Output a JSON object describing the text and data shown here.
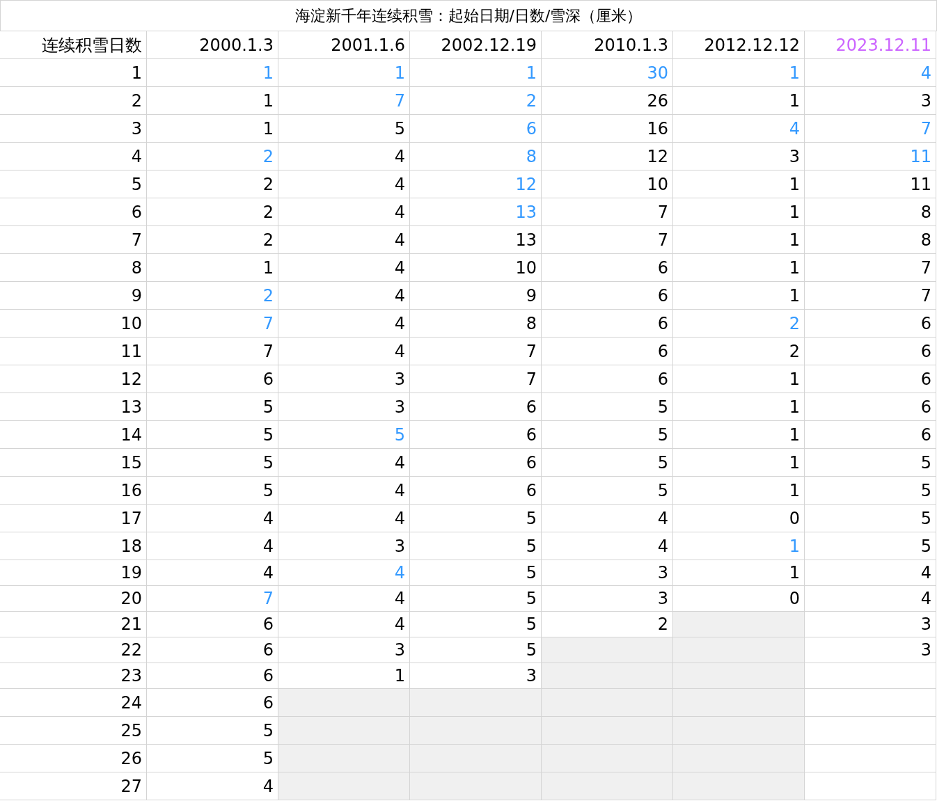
{
  "title": "海淀新千年连续积雪：起始日期/日数/雪深（厘米）",
  "columns": [
    {
      "label": "连续积雪日数"
    },
    {
      "label": "2000.1.3"
    },
    {
      "label": "2001.1.6"
    },
    {
      "label": "2002.12.19"
    },
    {
      "label": "2010.1.3"
    },
    {
      "label": "2012.12.12"
    },
    {
      "label": "2023.12.11",
      "color": "#cc66ff"
    }
  ],
  "rows": [
    {
      "day": "1",
      "cells": [
        {
          "value": "1",
          "highlight": true
        },
        {
          "value": "1",
          "highlight": true
        },
        {
          "value": "1",
          "highlight": true
        },
        {
          "value": "30",
          "highlight": true
        },
        {
          "value": "1",
          "highlight": true
        },
        {
          "value": "4",
          "highlight": true
        }
      ]
    },
    {
      "day": "2",
      "cells": [
        {
          "value": "1",
          "highlight": false
        },
        {
          "value": "7",
          "highlight": true
        },
        {
          "value": "2",
          "highlight": true
        },
        {
          "value": "26",
          "highlight": false
        },
        {
          "value": "1",
          "highlight": false
        },
        {
          "value": "3",
          "highlight": false
        }
      ]
    },
    {
      "day": "3",
      "cells": [
        {
          "value": "1",
          "highlight": false
        },
        {
          "value": "5",
          "highlight": false
        },
        {
          "value": "6",
          "highlight": true
        },
        {
          "value": "16",
          "highlight": false
        },
        {
          "value": "4",
          "highlight": true
        },
        {
          "value": "7",
          "highlight": true
        }
      ]
    },
    {
      "day": "4",
      "cells": [
        {
          "value": "2",
          "highlight": true
        },
        {
          "value": "4",
          "highlight": false
        },
        {
          "value": "8",
          "highlight": true
        },
        {
          "value": "12",
          "highlight": false
        },
        {
          "value": "3",
          "highlight": false
        },
        {
          "value": "11",
          "highlight": true
        }
      ]
    },
    {
      "day": "5",
      "cells": [
        {
          "value": "2",
          "highlight": false
        },
        {
          "value": "4",
          "highlight": false
        },
        {
          "value": "12",
          "highlight": true
        },
        {
          "value": "10",
          "highlight": false
        },
        {
          "value": "1",
          "highlight": false
        },
        {
          "value": "11",
          "highlight": false
        }
      ]
    },
    {
      "day": "6",
      "cells": [
        {
          "value": "2",
          "highlight": false
        },
        {
          "value": "4",
          "highlight": false
        },
        {
          "value": "13",
          "highlight": true
        },
        {
          "value": "7",
          "highlight": false
        },
        {
          "value": "1",
          "highlight": false
        },
        {
          "value": "8",
          "highlight": false
        }
      ]
    },
    {
      "day": "7",
      "cells": [
        {
          "value": "2",
          "highlight": false
        },
        {
          "value": "4",
          "highlight": false
        },
        {
          "value": "13",
          "highlight": false
        },
        {
          "value": "7",
          "highlight": false
        },
        {
          "value": "1",
          "highlight": false
        },
        {
          "value": "8",
          "highlight": false
        }
      ]
    },
    {
      "day": "8",
      "cells": [
        {
          "value": "1",
          "highlight": false
        },
        {
          "value": "4",
          "highlight": false
        },
        {
          "value": "10",
          "highlight": false
        },
        {
          "value": "6",
          "highlight": false
        },
        {
          "value": "1",
          "highlight": false
        },
        {
          "value": "7",
          "highlight": false
        }
      ]
    },
    {
      "day": "9",
      "cells": [
        {
          "value": "2",
          "highlight": true
        },
        {
          "value": "4",
          "highlight": false
        },
        {
          "value": "9",
          "highlight": false
        },
        {
          "value": "6",
          "highlight": false
        },
        {
          "value": "1",
          "highlight": false
        },
        {
          "value": "7",
          "highlight": false
        }
      ]
    },
    {
      "day": "10",
      "cells": [
        {
          "value": "7",
          "highlight": true
        },
        {
          "value": "4",
          "highlight": false
        },
        {
          "value": "8",
          "highlight": false
        },
        {
          "value": "6",
          "highlight": false
        },
        {
          "value": "2",
          "highlight": true
        },
        {
          "value": "6",
          "highlight": false
        }
      ]
    },
    {
      "day": "11",
      "cells": [
        {
          "value": "7",
          "highlight": false
        },
        {
          "value": "4",
          "highlight": false
        },
        {
          "value": "7",
          "highlight": false
        },
        {
          "value": "6",
          "highlight": false
        },
        {
          "value": "2",
          "highlight": false
        },
        {
          "value": "6",
          "highlight": false
        }
      ]
    },
    {
      "day": "12",
      "cells": [
        {
          "value": "6",
          "highlight": false
        },
        {
          "value": "3",
          "highlight": false
        },
        {
          "value": "7",
          "highlight": false
        },
        {
          "value": "6",
          "highlight": false
        },
        {
          "value": "1",
          "highlight": false
        },
        {
          "value": "6",
          "highlight": false
        }
      ]
    },
    {
      "day": "13",
      "cells": [
        {
          "value": "5",
          "highlight": false
        },
        {
          "value": "3",
          "highlight": false
        },
        {
          "value": "6",
          "highlight": false
        },
        {
          "value": "5",
          "highlight": false
        },
        {
          "value": "1",
          "highlight": false
        },
        {
          "value": "6",
          "highlight": false
        }
      ]
    },
    {
      "day": "14",
      "cells": [
        {
          "value": "5",
          "highlight": false
        },
        {
          "value": "5",
          "highlight": true
        },
        {
          "value": "6",
          "highlight": false
        },
        {
          "value": "5",
          "highlight": false
        },
        {
          "value": "1",
          "highlight": false
        },
        {
          "value": "6",
          "highlight": false
        }
      ]
    },
    {
      "day": "15",
      "cells": [
        {
          "value": "5",
          "highlight": false
        },
        {
          "value": "4",
          "highlight": false
        },
        {
          "value": "6",
          "highlight": false
        },
        {
          "value": "5",
          "highlight": false
        },
        {
          "value": "1",
          "highlight": false
        },
        {
          "value": "5",
          "highlight": false
        }
      ]
    },
    {
      "day": "16",
      "cells": [
        {
          "value": "5",
          "highlight": false
        },
        {
          "value": "4",
          "highlight": false
        },
        {
          "value": "6",
          "highlight": false
        },
        {
          "value": "5",
          "highlight": false
        },
        {
          "value": "1",
          "highlight": false
        },
        {
          "value": "5",
          "highlight": false
        }
      ]
    },
    {
      "day": "17",
      "cells": [
        {
          "value": "4",
          "highlight": false
        },
        {
          "value": "4",
          "highlight": false
        },
        {
          "value": "5",
          "highlight": false
        },
        {
          "value": "4",
          "highlight": false
        },
        {
          "value": "0",
          "highlight": false
        },
        {
          "value": "5",
          "highlight": false
        }
      ]
    },
    {
      "day": "18",
      "cells": [
        {
          "value": "4",
          "highlight": false
        },
        {
          "value": "3",
          "highlight": false
        },
        {
          "value": "5",
          "highlight": false
        },
        {
          "value": "4",
          "highlight": false
        },
        {
          "value": "1",
          "highlight": true
        },
        {
          "value": "5",
          "highlight": false
        }
      ]
    },
    {
      "day": "19",
      "cells": [
        {
          "value": "4",
          "highlight": false
        },
        {
          "value": "4",
          "highlight": true
        },
        {
          "value": "5",
          "highlight": false
        },
        {
          "value": "3",
          "highlight": false
        },
        {
          "value": "1",
          "highlight": false
        },
        {
          "value": "4",
          "highlight": false
        }
      ]
    },
    {
      "day": "20",
      "cells": [
        {
          "value": "7",
          "highlight": true
        },
        {
          "value": "4",
          "highlight": false
        },
        {
          "value": "5",
          "highlight": false
        },
        {
          "value": "3",
          "highlight": false
        },
        {
          "value": "0",
          "highlight": false
        },
        {
          "value": "4",
          "highlight": false
        }
      ]
    },
    {
      "day": "21",
      "cells": [
        {
          "value": "6",
          "highlight": false
        },
        {
          "value": "4",
          "highlight": false
        },
        {
          "value": "5",
          "highlight": false
        },
        {
          "value": "2",
          "highlight": false
        },
        {
          "shaded": true
        },
        {
          "value": "3",
          "highlight": false
        }
      ]
    },
    {
      "day": "22",
      "cells": [
        {
          "value": "6",
          "highlight": false
        },
        {
          "value": "3",
          "highlight": false
        },
        {
          "value": "5",
          "highlight": false
        },
        {
          "shaded": true
        },
        {
          "shaded": true
        },
        {
          "value": "3",
          "highlight": false
        }
      ]
    },
    {
      "day": "23",
      "cells": [
        {
          "value": "6",
          "highlight": false
        },
        {
          "value": "1",
          "highlight": false
        },
        {
          "value": "3",
          "highlight": false
        },
        {
          "shaded": true
        },
        {
          "shaded": true
        }
      ]
    },
    {
      "day": "24",
      "cells": [
        {
          "value": "6",
          "highlight": false
        },
        {
          "shaded": true
        },
        {
          "shaded": true
        },
        {
          "shaded": true
        },
        {
          "shaded": true
        }
      ]
    },
    {
      "day": "25",
      "cells": [
        {
          "value": "5",
          "highlight": false
        },
        {
          "shaded": true
        },
        {
          "shaded": true
        },
        {
          "shaded": true
        },
        {
          "shaded": true
        }
      ]
    },
    {
      "day": "26",
      "cells": [
        {
          "value": "5",
          "highlight": false
        },
        {
          "shaded": true
        },
        {
          "shaded": true
        },
        {
          "shaded": true
        },
        {
          "shaded": true
        }
      ]
    },
    {
      "day": "27",
      "cells": [
        {
          "value": "4",
          "highlight": false
        },
        {
          "shaded": true
        },
        {
          "shaded": true
        },
        {
          "shaded": true
        },
        {
          "shaded": true
        }
      ]
    }
  ]
}
